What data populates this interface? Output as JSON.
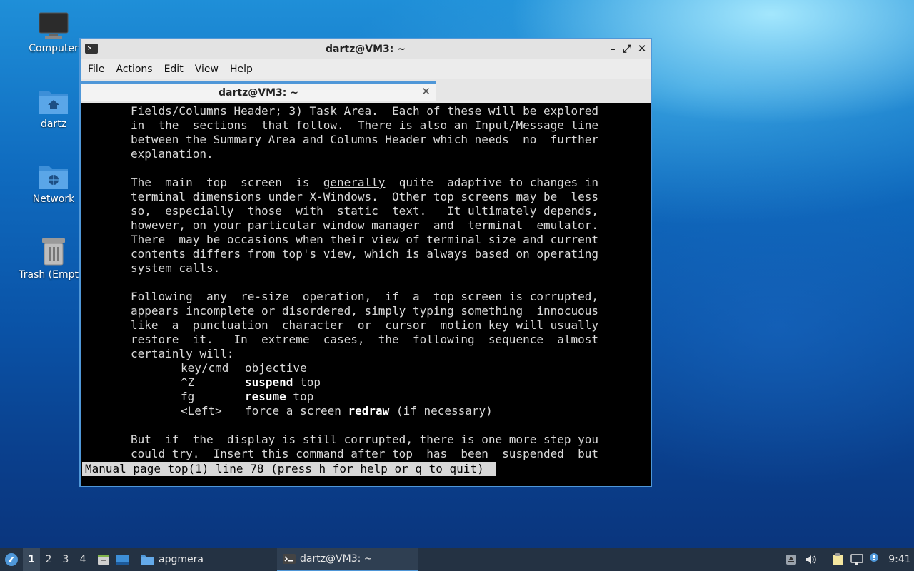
{
  "desktop": {
    "icons": [
      {
        "label": "Computer"
      },
      {
        "label": "dartz"
      },
      {
        "label": "Network"
      },
      {
        "label": "Trash (Empty)"
      }
    ]
  },
  "window": {
    "title": "dartz@VM3: ~",
    "controls": {
      "minimize": "–",
      "maximize": "⤢",
      "close": "✕"
    },
    "menu": {
      "file": "File",
      "actions": "Actions",
      "edit": "Edit",
      "view": "View",
      "help": "Help"
    },
    "tab": {
      "title": "dartz@VM3: ~",
      "close": "✕"
    }
  },
  "terminal": {
    "l1": "Fields/Columns Header; 3) Task Area.  Each of these will be explored",
    "l2": "in  the  sections  that follow.  There is also an Input/Message line",
    "l3": "between the Summary Area and Columns Header which needs  no  further",
    "l4": "explanation.",
    "l5a": "The  main  top  screen  is  ",
    "l5b": "generally",
    "l5c": "  quite  adaptive to changes in",
    "l6": "terminal dimensions under X-Windows.  Other top screens may be  less",
    "l7": "so,  especially  those  with  static  text.   It ultimately depends,",
    "l8": "however, on your particular window manager  and  terminal  emulator.",
    "l9": "There  may be occasions when their view of terminal size and current",
    "l10": "contents differs from top's view, which is always based on operating",
    "l11": "system calls.",
    "l12": "Following  any  re-size  operation,  if  a  top screen is corrupted,",
    "l13": "appears incomplete or disordered, simply typing something  innocuous",
    "l14": "like  a  punctuation  character  or  cursor  motion key will usually",
    "l15": "restore  it.   In  extreme  cases,  the  following  sequence  almost",
    "l16": "certainly will:",
    "t_head_key": "key/cmd",
    "t_head_obj": "objective",
    "t1_key": "^Z",
    "t1_bold": "suspend",
    "t1_rest": " top",
    "t2_key": "fg",
    "t2_bold": "resume",
    "t2_rest": " top",
    "t3_key": "<Left>",
    "t3_pre": "force a screen ",
    "t3_bold": "redraw",
    "t3_rest": " (if necessary)",
    "l17": "But  if  the  display is still corrupted, there is one more step you",
    "l18": "could try.  Insert this command after top  has  been  suspended  but",
    "status": "Manual page top(1) line 78 (press h for help or q to quit)"
  },
  "taskbar": {
    "workspaces": [
      "1",
      "2",
      "3",
      "4"
    ],
    "tasks": {
      "folder": "apgmera",
      "terminal": "dartz@VM3: ~"
    },
    "clock": "9:41"
  },
  "colors": {
    "accent": "#4f97d8",
    "taskbar": "#243243",
    "terminal_bg": "#000000"
  }
}
